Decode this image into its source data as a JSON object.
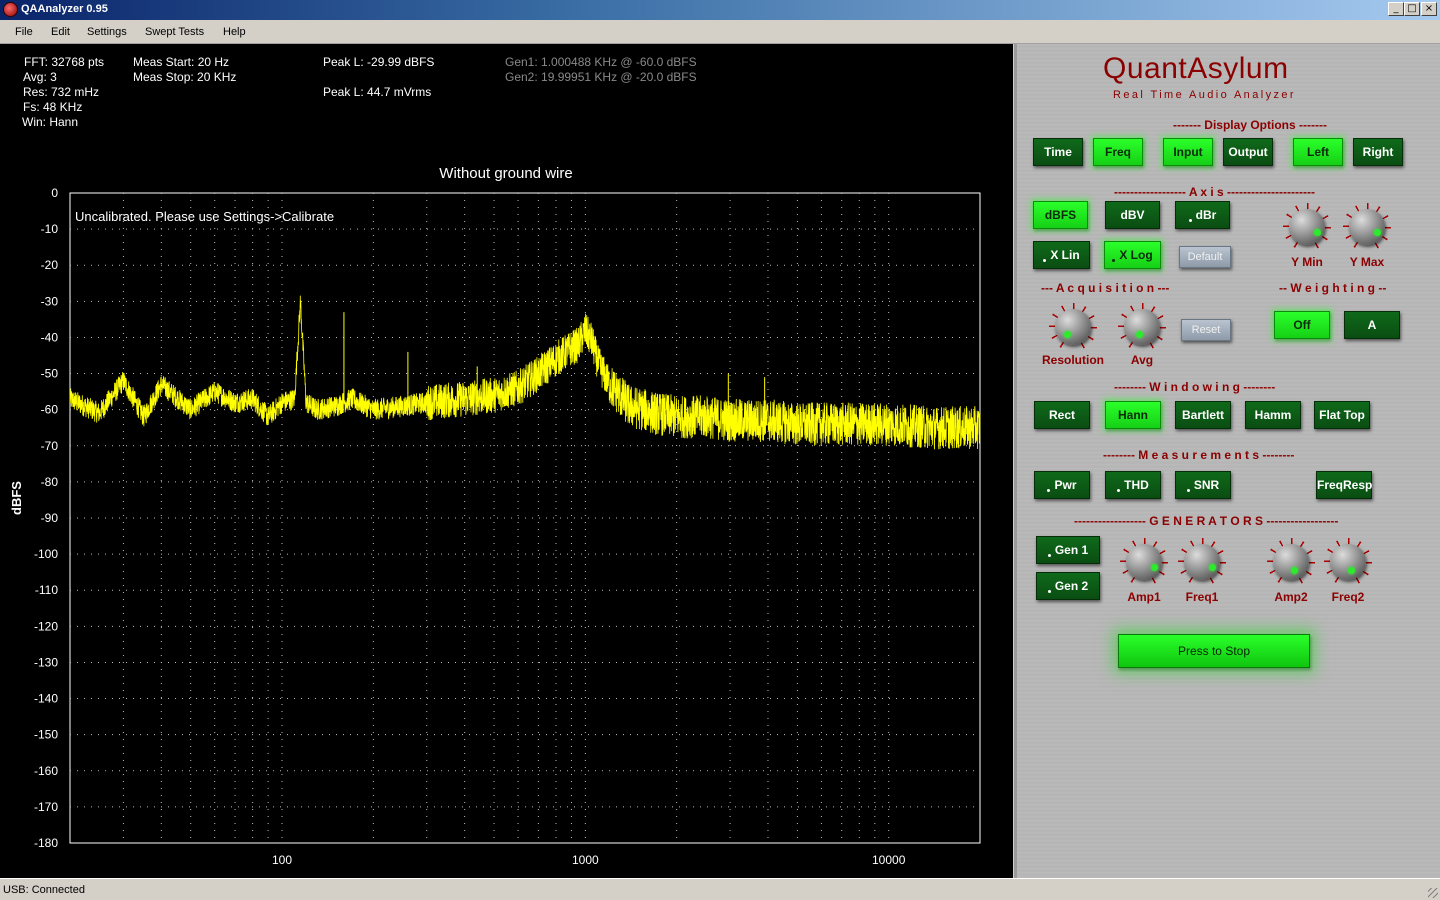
{
  "window": {
    "title": "QAAnalyzer 0.95",
    "minimize": "_",
    "maximize": "□",
    "close": "×"
  },
  "menu": [
    "File",
    "Edit",
    "Settings",
    "Swept Tests",
    "Help"
  ],
  "stats": {
    "fft": "FFT: 32768 pts",
    "avg": "Avg: 3",
    "res": "Res: 732 mHz",
    "fs": "Fs: 48 KHz",
    "win": "Win: Hann",
    "meas_start": "Meas Start: 20 Hz",
    "meas_stop": "Meas Stop: 20 KHz",
    "peak_dbfs": "Peak L: -29.99 dBFS",
    "peak_vrms": "Peak L: 44.7 mVrms",
    "gen1": "Gen1: 1.000488 KHz @ -60.0 dBFS",
    "gen2": "Gen2: 19.99951 KHz @ -20.0 dBFS"
  },
  "plot": {
    "title": "Without ground wire",
    "message": "Uncalibrated. Please use Settings->Calibrate"
  },
  "chart_data": {
    "type": "line",
    "title": "Without ground wire",
    "xlabel": "",
    "ylabel": "dBFS",
    "x_scale": "log",
    "xlim": [
      20,
      20000
    ],
    "ylim": [
      -180,
      0
    ],
    "x_ticks": [
      100,
      1000,
      10000
    ],
    "x_tick_labels": [
      "100",
      "1000",
      "10000"
    ],
    "y_ticks": [
      0,
      -10,
      -20,
      -30,
      -40,
      -50,
      -60,
      -70,
      -80,
      -90,
      -100,
      -110,
      -120,
      -130,
      -140,
      -150,
      -160,
      -170,
      -180
    ],
    "grid": true,
    "series": [
      {
        "color": "#ffff00",
        "x": [
          20,
          25,
          30,
          35,
          40,
          50,
          60,
          70,
          80,
          90,
          100,
          110,
          115,
          120,
          130,
          150,
          170,
          200,
          250,
          300,
          400,
          500,
          600,
          700,
          800,
          900,
          950,
          1000,
          1050,
          1100,
          1200,
          1400,
          1700,
          2000,
          2500,
          3000,
          4000,
          5000,
          7000,
          10000,
          14000,
          20000
        ],
        "y": [
          -57,
          -61,
          -52,
          -62,
          -53,
          -60,
          -55,
          -58,
          -57,
          -62,
          -58,
          -57,
          -30,
          -58,
          -60,
          -59,
          -57,
          -60,
          -59,
          -58,
          -57,
          -56,
          -54,
          -50,
          -46,
          -43,
          -42,
          -38,
          -41,
          -47,
          -53,
          -59,
          -61,
          -62,
          -62,
          -63,
          -63,
          -64,
          -64,
          -64,
          -65,
          -65
        ]
      }
    ]
  },
  "panel": {
    "brand": "QuantAsylum",
    "subtitle": "Real Time Audio Analyzer",
    "display_options": "------- Display Options -------",
    "axis": "------------------ A x i s ----------------------",
    "acquisition": "--- A c q u i s i t i o n ---",
    "weighting": "-- W e i g h t i n g --",
    "windowing": "-------- W i n d o w i n g --------",
    "measurements": "-------- M e a s u r e m e n t s --------",
    "generators": "------------------ G E N E R A T O R S ------------------",
    "buttons": {
      "time": "Time",
      "freq": "Freq",
      "input": "Input",
      "output": "Output",
      "left": "Left",
      "right": "Right",
      "dbfs": "dBFS",
      "dbv": "dBV",
      "dbr": "dBr",
      "xlin": "X Lin",
      "xlog": "X Log",
      "default": "Default",
      "reset": "Reset",
      "off": "Off",
      "a": "A",
      "rect": "Rect",
      "hann": "Hann",
      "bartlett": "Bartlett",
      "hamm": "Hamm",
      "flattop": "Flat Top",
      "pwr": "Pwr",
      "thd": "THD",
      "snr": "SNR",
      "freqresp": "FreqResp",
      "gen1": "Gen 1",
      "gen2": "Gen 2",
      "stop": "Press to Stop"
    },
    "knobs": {
      "ymin": "Y Min",
      "ymax": "Y Max",
      "resolution": "Resolution",
      "avg": "Avg",
      "amp1": "Amp1",
      "freq1": "Freq1",
      "amp2": "Amp2",
      "freq2": "Freq2"
    }
  },
  "status": "USB: Connected"
}
